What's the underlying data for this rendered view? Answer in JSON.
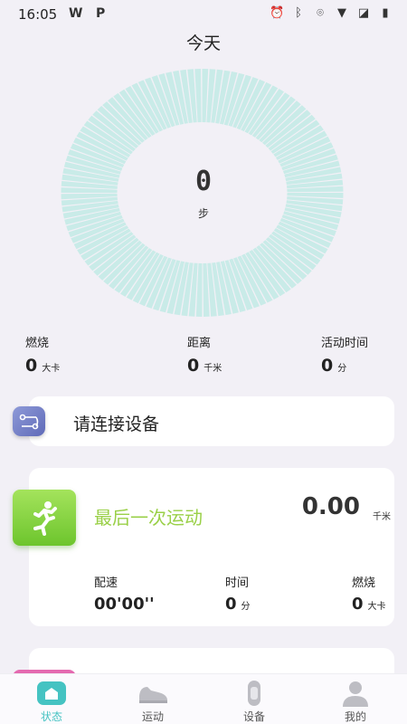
{
  "status_bar": {
    "time": "16:05",
    "app_icon_1": "W",
    "app_icon_2": "P",
    "icons": [
      "alarm-icon",
      "bluetooth-icon",
      "location-icon",
      "wifi-icon",
      "no-signal-icon",
      "battery-icon"
    ]
  },
  "page": {
    "title": "今天"
  },
  "steps": {
    "value": "0",
    "unit": "步",
    "progress": 0
  },
  "stats": [
    {
      "label": "燃烧",
      "value": "0",
      "unit": "大卡"
    },
    {
      "label": "距离",
      "value": "0",
      "unit": "千米"
    },
    {
      "label": "活动时间",
      "value": "0",
      "unit": "分"
    }
  ],
  "connect": {
    "label": "请连接设备"
  },
  "last_exercise": {
    "title": "最后一次运动",
    "distance": "0.00",
    "distance_unit": "千米",
    "pace_label": "配速",
    "pace_value": "00'00''",
    "time_label": "时间",
    "time_value": "0",
    "time_unit": "分",
    "burn_label": "燃烧",
    "burn_value": "0",
    "burn_unit": "大卡"
  },
  "tabs": [
    {
      "label": "状态",
      "icon": "home-icon",
      "active": true
    },
    {
      "label": "运动",
      "icon": "sneaker-icon",
      "active": false
    },
    {
      "label": "设备",
      "icon": "band-icon",
      "active": false
    },
    {
      "label": "我的",
      "icon": "person-icon",
      "active": false
    }
  ],
  "colors": {
    "accent": "#45c3c2",
    "ring": "#c9ebe8",
    "exercise_title": "#9ad048",
    "run_icon": "#7fd23a",
    "connect_icon": "#6f7bc6"
  }
}
